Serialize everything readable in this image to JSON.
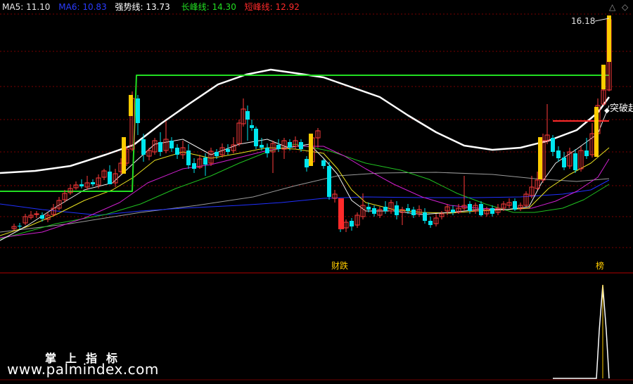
{
  "legend": {
    "ma5": {
      "label": "MA5:",
      "value": "11.10",
      "color": "#e8e8e8"
    },
    "ma6": {
      "label": "MA6:",
      "value": "10.83",
      "color": "#2a3cff"
    },
    "strong": {
      "label": "强势线:",
      "value": "13.73",
      "color": "#ffffff"
    },
    "long": {
      "label": "长峰线:",
      "value": "14.30",
      "color": "#22dd22"
    },
    "short": {
      "label": "短峰线:",
      "value": "12.92",
      "color": "#ff2a2a"
    }
  },
  "controls": {
    "up": "△",
    "diamond": "◇"
  },
  "annotations": {
    "price_peak": "16.18",
    "breakout": "突破起",
    "signal_left": "财跌",
    "signal_right": "榜"
  },
  "watermark": {
    "cn": "掌上指标",
    "url": "www.palmindex.com"
  },
  "colors": {
    "up": "#ff3b3b",
    "down": "#00e5ee",
    "signal_bar": "#ffcc00",
    "grid": "#7a0000",
    "bg": "#000000"
  },
  "chart_data": {
    "type": "candlestick",
    "series": [
      {
        "name": "MA5",
        "value": 11.1
      },
      {
        "name": "MA6",
        "value": 10.83
      },
      {
        "name": "强势线",
        "value": 13.73
      },
      {
        "name": "长峰线",
        "value": 14.3
      },
      {
        "name": "短峰线",
        "value": 12.92
      }
    ],
    "candles": [
      [
        20,
        325,
        322,
        328,
        318
      ],
      [
        28,
        321,
        322,
        326,
        317
      ],
      [
        36,
        317,
        308,
        320,
        304
      ],
      [
        44,
        309,
        306,
        312,
        300
      ],
      [
        52,
        305,
        304,
        310,
        300
      ],
      [
        60,
        306,
        311,
        315,
        302
      ],
      [
        68,
        312,
        306,
        316,
        302
      ],
      [
        76,
        305,
        296,
        308,
        290
      ],
      [
        84,
        296,
        285,
        299,
        280
      ],
      [
        92,
        284,
        275,
        288,
        270
      ],
      [
        100,
        274,
        268,
        277,
        262
      ],
      [
        108,
        267,
        263,
        270,
        258
      ],
      [
        116,
        262,
        265,
        268,
        255
      ],
      [
        124,
        266,
        260,
        270,
        250
      ],
      [
        132,
        259,
        262,
        265,
        255
      ],
      [
        140,
        263,
        253,
        268,
        248
      ],
      [
        148,
        252,
        243,
        256,
        240
      ],
      [
        156,
        244,
        262,
        246,
        235
      ],
      [
        164,
        260,
        247,
        266,
        240
      ],
      [
        172,
        244,
        232,
        248,
        225
      ],
      [
        180,
        232,
        212,
        236,
        208
      ],
      [
        188,
        212,
        140,
        215,
        130
      ],
      [
        196,
        140,
        175,
        192,
        135
      ],
      [
        204,
        198,
        220,
        230,
        190
      ],
      [
        212,
        222,
        214,
        228,
        210
      ],
      [
        220,
        216,
        200,
        220,
        196
      ],
      [
        228,
        202,
        216,
        222,
        188
      ],
      [
        236,
        214,
        198,
        218,
        172
      ],
      [
        244,
        200,
        211,
        216,
        195
      ],
      [
        252,
        210,
        220,
        226,
        205
      ],
      [
        260,
        220,
        210,
        226,
        200
      ],
      [
        268,
        214,
        235,
        240,
        205
      ],
      [
        276,
        232,
        240,
        246,
        225
      ],
      [
        284,
        238,
        226,
        240,
        220
      ],
      [
        292,
        224,
        234,
        250,
        218
      ],
      [
        300,
        232,
        215,
        236,
        210
      ],
      [
        308,
        216,
        222,
        226,
        212
      ],
      [
        316,
        220,
        210,
        224,
        204
      ],
      [
        324,
        212,
        216,
        220,
        205
      ],
      [
        332,
        214,
        206,
        218,
        195
      ],
      [
        340,
        204,
        175,
        208,
        170
      ],
      [
        346,
        176,
        155,
        180,
        140
      ],
      [
        352,
        158,
        170,
        200,
        150
      ],
      [
        358,
        178,
        182,
        186,
        170
      ],
      [
        364,
        183,
        208,
        212,
        180
      ],
      [
        372,
        206,
        210,
        214,
        196
      ],
      [
        380,
        210,
        218,
        224,
        204
      ],
      [
        388,
        216,
        204,
        246,
        200
      ],
      [
        396,
        206,
        212,
        216,
        198
      ],
      [
        404,
        212,
        200,
        226,
        196
      ],
      [
        412,
        202,
        210,
        214,
        198
      ],
      [
        420,
        208,
        200,
        212,
        194
      ],
      [
        428,
        202,
        212,
        216,
        198
      ],
      [
        436,
        226,
        238,
        244,
        222
      ],
      [
        444,
        230,
        196,
        234,
        190
      ],
      [
        452,
        196,
        186,
        210,
        182
      ],
      [
        460,
        228,
        236,
        240,
        226
      ],
      [
        468,
        236,
        280,
        284,
        230
      ],
      [
        476,
        282,
        276,
        288,
        270
      ],
      [
        484,
        286,
        326,
        330,
        282
      ],
      [
        492,
        324,
        316,
        330,
        312
      ],
      [
        500,
        314,
        322,
        328,
        310
      ],
      [
        508,
        320,
        306,
        324,
        302
      ],
      [
        516,
        308,
        292,
        312,
        275
      ],
      [
        524,
        294,
        298,
        302,
        288
      ],
      [
        532,
        296,
        304,
        308,
        292
      ],
      [
        540,
        306,
        298,
        310,
        294
      ],
      [
        548,
        294,
        300,
        304,
        286
      ],
      [
        556,
        300,
        288,
        304,
        284
      ],
      [
        564,
        292,
        306,
        312,
        286
      ],
      [
        572,
        302,
        298,
        320,
        294
      ],
      [
        580,
        296,
        300,
        304,
        290
      ],
      [
        588,
        298,
        306,
        310,
        294
      ],
      [
        596,
        304,
        298,
        308,
        292
      ],
      [
        604,
        302,
        314,
        318,
        296
      ],
      [
        612,
        314,
        320,
        324,
        308
      ],
      [
        620,
        318,
        310,
        322,
        304
      ],
      [
        628,
        308,
        304,
        312,
        300
      ],
      [
        636,
        300,
        294,
        306,
        290
      ],
      [
        644,
        298,
        302,
        306,
        292
      ],
      [
        652,
        302,
        296,
        304,
        290
      ],
      [
        660,
        296,
        292,
        300,
        250
      ],
      [
        668,
        290,
        300,
        304,
        286
      ],
      [
        676,
        300,
        292,
        304,
        288
      ],
      [
        684,
        290,
        306,
        308,
        286
      ],
      [
        692,
        304,
        298,
        308,
        294
      ],
      [
        700,
        296,
        304,
        308,
        292
      ],
      [
        708,
        302,
        296,
        306,
        290
      ],
      [
        716,
        296,
        290,
        300,
        286
      ],
      [
        724,
        292,
        288,
        296,
        282
      ],
      [
        732,
        286,
        298,
        300,
        282
      ],
      [
        740,
        296,
        292,
        300,
        288
      ],
      [
        748,
        292,
        276,
        294,
        272
      ],
      [
        756,
        278,
        266,
        282,
        250
      ],
      [
        764,
        268,
        256,
        270,
        244
      ],
      [
        772,
        256,
        200,
        260,
        190
      ],
      [
        778,
        200,
        192,
        205,
        148
      ],
      [
        786,
        196,
        216,
        222,
        192
      ],
      [
        794,
        214,
        225,
        230,
        208
      ],
      [
        802,
        224,
        238,
        242,
        216
      ],
      [
        810,
        236,
        216,
        240,
        210
      ],
      [
        818,
        218,
        242,
        246,
        212
      ],
      [
        826,
        240,
        214,
        244,
        208
      ],
      [
        834,
        214,
        222,
        226,
        196
      ],
      [
        842,
        220,
        190,
        224,
        175
      ],
      [
        850,
        190,
        150,
        196,
        140
      ],
      [
        858,
        148,
        128,
        150,
        124
      ],
      [
        866,
        128,
        28,
        130,
        22
      ]
    ],
    "signal_bars": [
      [
        176,
        247,
        195
      ],
      [
        186,
        165,
        135
      ],
      [
        442,
        236,
        190
      ],
      [
        768,
        255,
        195
      ],
      [
        848,
        223,
        152
      ],
      [
        858,
        127,
        92
      ],
      [
        866,
        88,
        28
      ]
    ],
    "lines": {
      "strong": [
        [
          0,
          246
        ],
        [
          50,
          243
        ],
        [
          100,
          236
        ],
        [
          150,
          220
        ],
        [
          190,
          206
        ],
        [
          230,
          175
        ],
        [
          270,
          147
        ],
        [
          310,
          120
        ],
        [
          350,
          106
        ],
        [
          385,
          99
        ],
        [
          420,
          104
        ],
        [
          460,
          110
        ],
        [
          500,
          124
        ],
        [
          540,
          138
        ],
        [
          580,
          164
        ],
        [
          620,
          188
        ],
        [
          660,
          207
        ],
        [
          700,
          213
        ],
        [
          740,
          210
        ],
        [
          780,
          200
        ],
        [
          820,
          185
        ],
        [
          850,
          160
        ],
        [
          866,
          138
        ]
      ],
      "long": [
        [
          0,
          272
        ],
        [
          188,
          272
        ],
        [
          194,
          107
        ],
        [
          866,
          107
        ]
      ],
      "short": [
        [
          786,
          172
        ],
        [
          866,
          172
        ]
      ],
      "ma_white": [
        [
          0,
          342
        ],
        [
          40,
          320
        ],
        [
          80,
          294
        ],
        [
          120,
          270
        ],
        [
          160,
          260
        ],
        [
          190,
          232
        ],
        [
          220,
          205
        ],
        [
          260,
          198
        ],
        [
          300,
          220
        ],
        [
          340,
          205
        ],
        [
          380,
          198
        ],
        [
          410,
          210
        ],
        [
          440,
          205
        ],
        [
          460,
          225
        ],
        [
          480,
          248
        ],
        [
          500,
          285
        ],
        [
          520,
          300
        ],
        [
          560,
          300
        ],
        [
          600,
          305
        ],
        [
          640,
          302
        ],
        [
          680,
          298
        ],
        [
          720,
          298
        ],
        [
          752,
          294
        ],
        [
          770,
          260
        ],
        [
          790,
          232
        ],
        [
          820,
          212
        ],
        [
          850,
          190
        ],
        [
          866,
          150
        ]
      ],
      "ma_yellow": [
        [
          0,
          335
        ],
        [
          40,
          322
        ],
        [
          80,
          305
        ],
        [
          120,
          285
        ],
        [
          160,
          270
        ],
        [
          190,
          252
        ],
        [
          220,
          228
        ],
        [
          260,
          216
        ],
        [
          300,
          225
        ],
        [
          340,
          218
        ],
        [
          380,
          210
        ],
        [
          420,
          212
        ],
        [
          460,
          218
        ],
        [
          480,
          240
        ],
        [
          500,
          270
        ],
        [
          520,
          288
        ],
        [
          560,
          298
        ],
        [
          600,
          302
        ],
        [
          640,
          303
        ],
        [
          680,
          300
        ],
        [
          720,
          298
        ],
        [
          752,
          296
        ],
        [
          780,
          268
        ],
        [
          810,
          248
        ],
        [
          840,
          232
        ],
        [
          866,
          210
        ]
      ],
      "ma_magenta": [
        [
          0,
          338
        ],
        [
          60,
          330
        ],
        [
          120,
          310
        ],
        [
          170,
          288
        ],
        [
          210,
          260
        ],
        [
          260,
          240
        ],
        [
          300,
          234
        ],
        [
          340,
          224
        ],
        [
          380,
          214
        ],
        [
          420,
          208
        ],
        [
          460,
          208
        ],
        [
          490,
          222
        ],
        [
          520,
          240
        ],
        [
          560,
          262
        ],
        [
          600,
          280
        ],
        [
          640,
          292
        ],
        [
          680,
          296
        ],
        [
          720,
          298
        ],
        [
          756,
          296
        ],
        [
          790,
          286
        ],
        [
          820,
          272
        ],
        [
          850,
          252
        ],
        [
          866,
          226
        ]
      ],
      "ma_green": [
        [
          0,
          340
        ],
        [
          80,
          318
        ],
        [
          150,
          305
        ],
        [
          200,
          290
        ],
        [
          250,
          268
        ],
        [
          300,
          250
        ],
        [
          340,
          232
        ],
        [
          380,
          216
        ],
        [
          420,
          205
        ],
        [
          470,
          215
        ],
        [
          520,
          232
        ],
        [
          570,
          242
        ],
        [
          610,
          255
        ],
        [
          650,
          275
        ],
        [
          690,
          290
        ],
        [
          730,
          302
        ],
        [
          760,
          302
        ],
        [
          800,
          296
        ],
        [
          830,
          284
        ],
        [
          866,
          262
        ]
      ],
      "ma_gray": [
        [
          0,
          330
        ],
        [
          100,
          318
        ],
        [
          200,
          302
        ],
        [
          280,
          292
        ],
        [
          360,
          280
        ],
        [
          420,
          264
        ],
        [
          480,
          250
        ],
        [
          540,
          246
        ],
        [
          620,
          245
        ],
        [
          700,
          248
        ],
        [
          760,
          254
        ],
        [
          820,
          258
        ],
        [
          866,
          254
        ]
      ],
      "ma_blue": [
        [
          0,
          290
        ],
        [
          60,
          298
        ],
        [
          140,
          306
        ],
        [
          200,
          300
        ],
        [
          260,
          296
        ],
        [
          340,
          292
        ],
        [
          400,
          288
        ],
        [
          460,
          282
        ],
        [
          520,
          280
        ],
        [
          600,
          281
        ],
        [
          680,
          281
        ],
        [
          740,
          280
        ],
        [
          800,
          276
        ],
        [
          840,
          270
        ],
        [
          866,
          256
        ]
      ]
    },
    "indicator": [
      [
        786,
        538
      ],
      [
        848,
        538
      ],
      [
        852,
        470
      ],
      [
        857,
        405
      ],
      [
        862,
        470
      ],
      [
        866,
        538
      ]
    ]
  }
}
